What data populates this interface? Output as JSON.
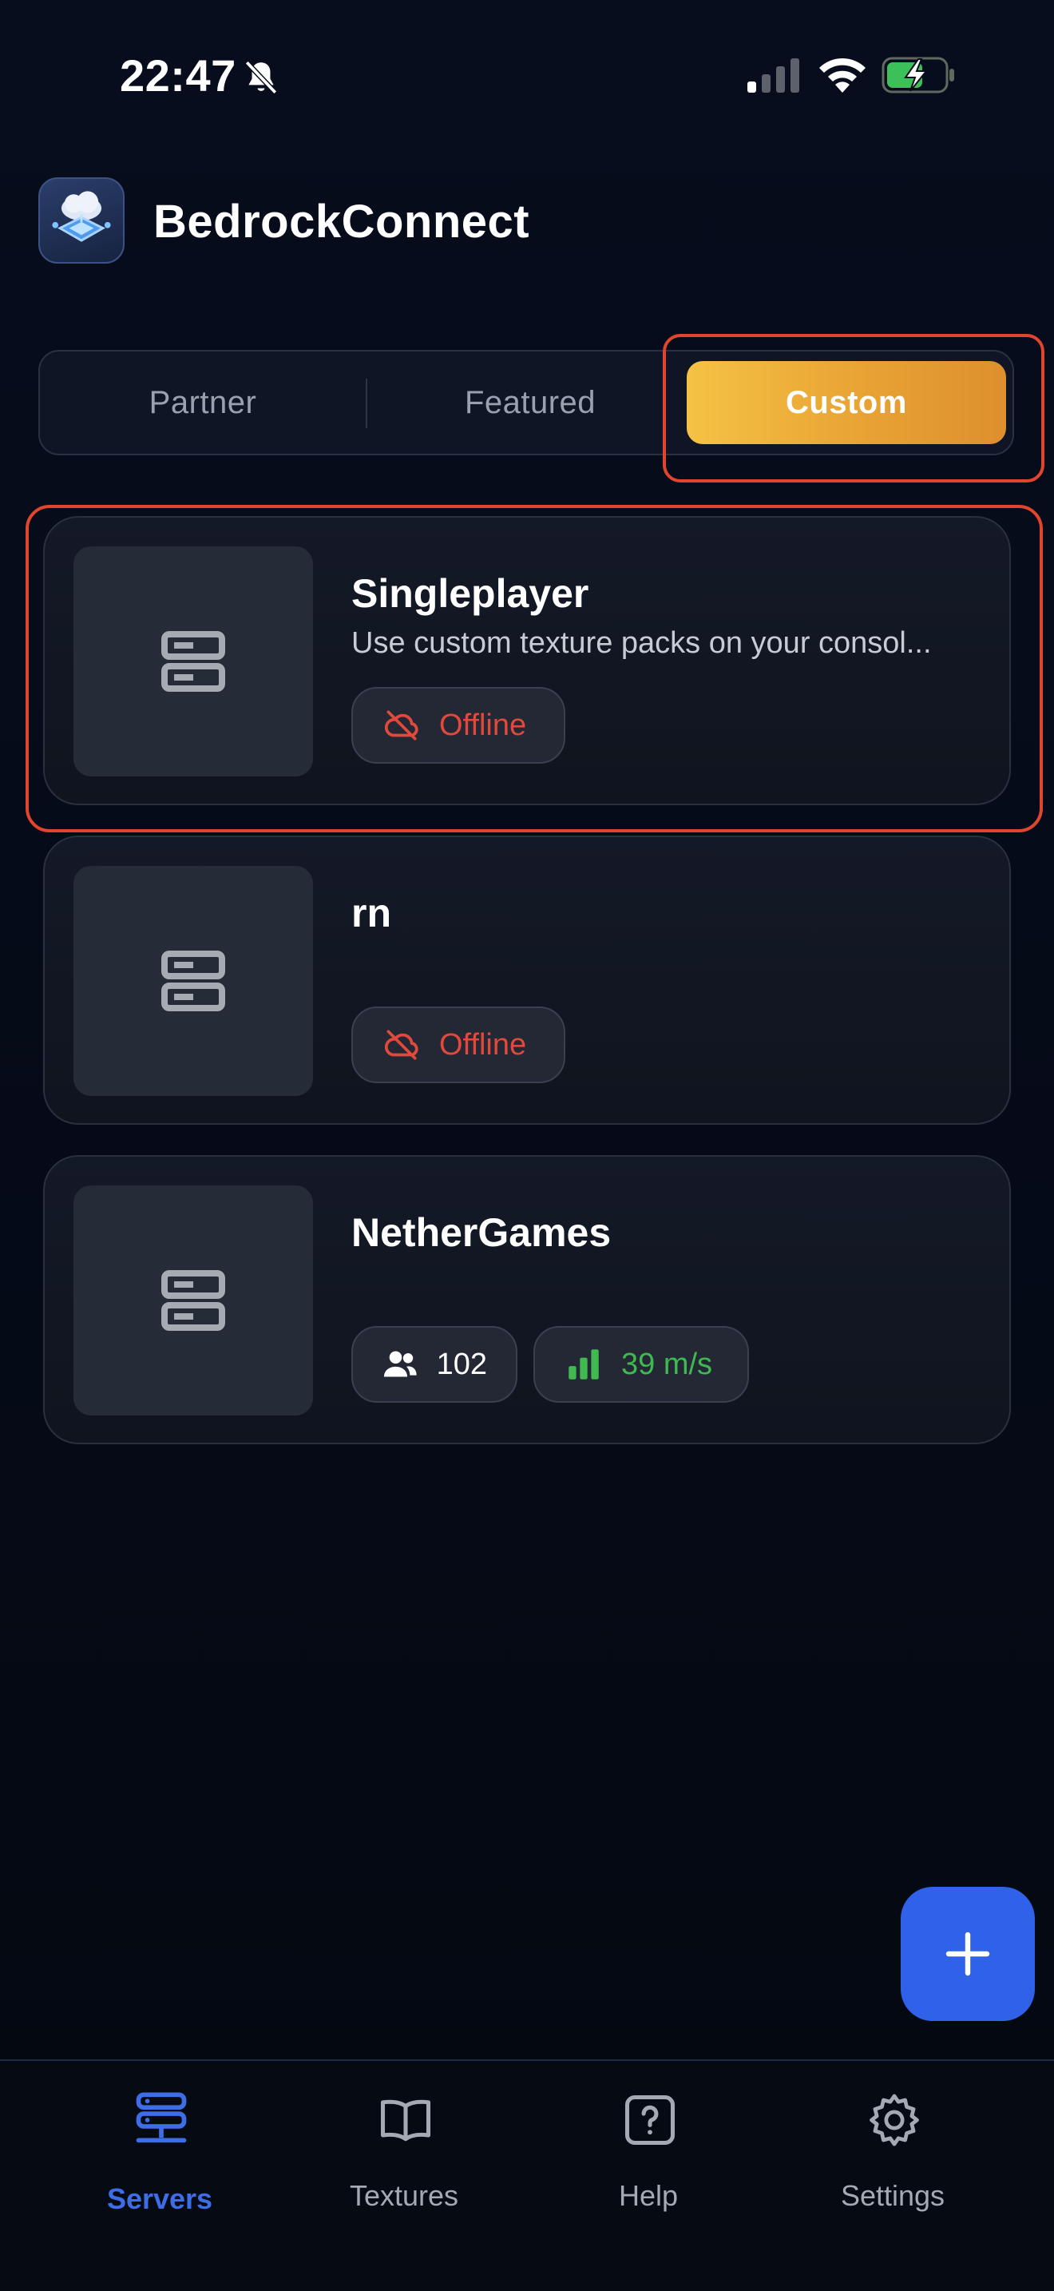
{
  "status_bar": {
    "time": "22:47",
    "icons": [
      "bell-slash-icon",
      "cellular-signal-icon",
      "wifi-icon",
      "battery-charging-icon"
    ]
  },
  "header": {
    "app_title": "BedrockConnect",
    "logo_icon": "app-logo-icon"
  },
  "tabs": {
    "items": [
      {
        "label": "Partner",
        "selected": false
      },
      {
        "label": "Featured",
        "selected": false
      },
      {
        "label": "Custom",
        "selected": true
      }
    ]
  },
  "servers": [
    {
      "name": "Singleplayer",
      "description": "Use custom texture packs on your consol...",
      "status": "Offline",
      "icon": "server-icon"
    },
    {
      "name": "rn",
      "description": "",
      "status": "Offline",
      "icon": "server-icon"
    },
    {
      "name": "NetherGames",
      "players": "102",
      "ping": "39 m/s",
      "icon": "server-icon"
    }
  ],
  "fab": {
    "icon": "plus-icon"
  },
  "bottom_nav": {
    "items": [
      {
        "label": "Servers",
        "icon": "servers-icon",
        "active": true
      },
      {
        "label": "Textures",
        "icon": "book-icon",
        "active": false
      },
      {
        "label": "Help",
        "icon": "help-icon",
        "active": false
      },
      {
        "label": "Settings",
        "icon": "gear-icon",
        "active": false
      }
    ]
  },
  "colors": {
    "background": "#050a17",
    "accent_gold": "#f5c245",
    "accent_orange": "#de8f2e",
    "offline_red": "#e0493b",
    "ping_green": "#3fb950",
    "primary_blue": "#2f62e8",
    "highlight_outline": "#e2452d"
  }
}
